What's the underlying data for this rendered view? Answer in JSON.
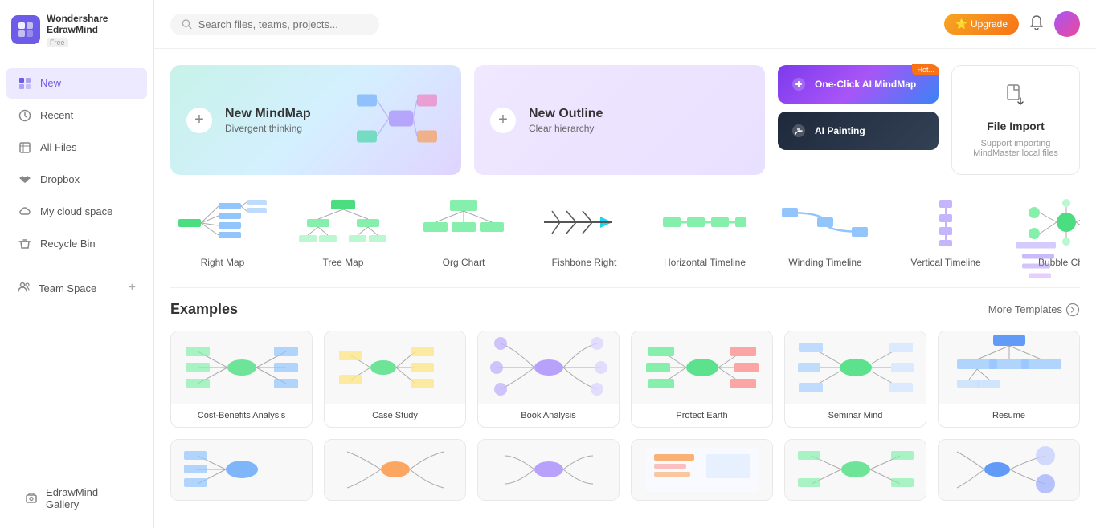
{
  "app": {
    "name": "Wondershare\nEdrawMind",
    "badge": "Free"
  },
  "sidebar": {
    "nav_items": [
      {
        "id": "new",
        "label": "New",
        "icon": "⊞",
        "active": true
      },
      {
        "id": "recent",
        "label": "Recent",
        "icon": "🕐",
        "active": false
      },
      {
        "id": "all-files",
        "label": "All Files",
        "icon": "📄",
        "active": false
      },
      {
        "id": "dropbox",
        "label": "Dropbox",
        "icon": "📦",
        "active": false
      },
      {
        "id": "my-cloud",
        "label": "My cloud space",
        "icon": "☁️",
        "active": false
      },
      {
        "id": "recycle",
        "label": "Recycle Bin",
        "icon": "🗑️",
        "active": false
      }
    ],
    "team_space": "Team Space",
    "gallery": "EdrawMind Gallery"
  },
  "header": {
    "search_placeholder": "Search files, teams, projects...",
    "upgrade_label": "Upgrade"
  },
  "new_mindmap": {
    "title": "New MindMap",
    "subtitle": "Divergent thinking"
  },
  "new_outline": {
    "title": "New Outline",
    "subtitle": "Clear hierarchy"
  },
  "ai_mindmap": {
    "title": "One-Click AI MindMap",
    "badge": "Hot"
  },
  "ai_painting": {
    "title": "AI Painting"
  },
  "file_import": {
    "title": "File Import",
    "subtitle": "Support importing MindMaster local files"
  },
  "templates": [
    {
      "label": "Right Map"
    },
    {
      "label": "Tree Map"
    },
    {
      "label": "Org Chart"
    },
    {
      "label": "Fishbone Right"
    },
    {
      "label": "Horizontal Timeline"
    },
    {
      "label": "Winding Timeline"
    },
    {
      "label": "Vertical Timeline"
    },
    {
      "label": "Bubble Chart"
    }
  ],
  "examples": {
    "title": "Examples",
    "more_label": "More Templates",
    "row1": [
      {
        "label": "Cost-Benefits Analysis"
      },
      {
        "label": "Case Study"
      },
      {
        "label": "Book Analysis"
      },
      {
        "label": "Protect Earth"
      },
      {
        "label": "Seminar Mind"
      },
      {
        "label": "Resume"
      }
    ],
    "row2": [
      {
        "label": ""
      },
      {
        "label": ""
      },
      {
        "label": ""
      },
      {
        "label": ""
      },
      {
        "label": ""
      },
      {
        "label": ""
      }
    ]
  },
  "colors": {
    "accent": "#6c5ce7",
    "upgrade_start": "#f5a623",
    "upgrade_end": "#f97316"
  }
}
